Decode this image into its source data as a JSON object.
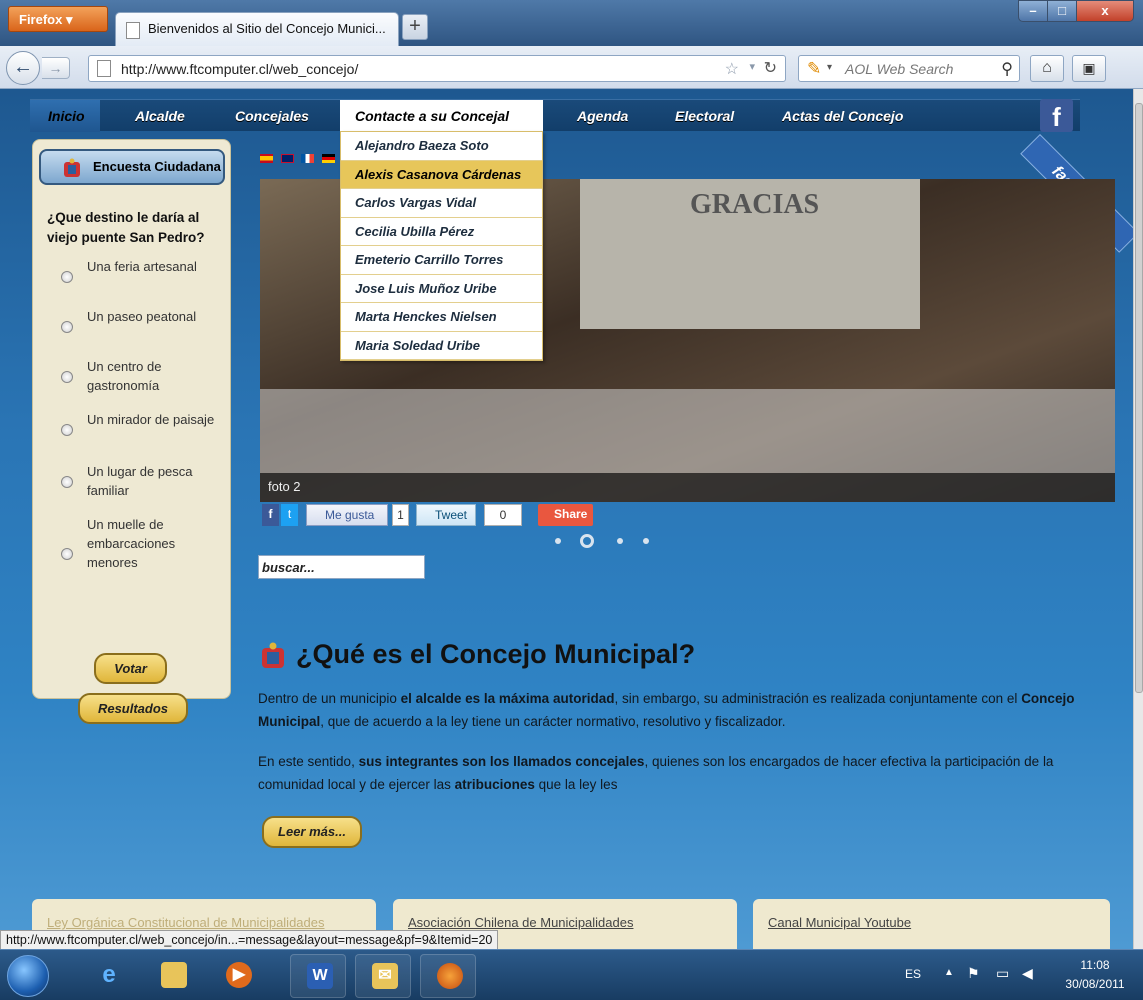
{
  "browser": {
    "menu_button": "Firefox ▾",
    "tab_title": "Bienvenidos al Sitio del Concejo Munici...",
    "new_tab": "+",
    "url": "http://www.ftcomputer.cl/web_concejo/",
    "search_placeholder": "AOL Web Search",
    "status_url": "http://www.ftcomputer.cl/web_concejo/in...=message&layout=message&pf=9&Itemid=20"
  },
  "menu": {
    "items": [
      "Inicio",
      "Alcalde",
      "Concejales",
      "Contacte a su Concejal",
      "Agenda",
      "Electoral",
      "Actas del Concejo"
    ]
  },
  "dropdown": {
    "items": [
      "Alejandro Baeza Soto",
      "Alexis Casanova Cárdenas",
      "Carlos Vargas Vidal",
      "Cecilia Ubilla Pérez",
      "Emeterio Carrillo Torres",
      "Jose Luis Muñoz Uribe",
      "Marta Henckes Nielsen",
      "Maria Soledad Uribe"
    ],
    "hover_index": 1
  },
  "facebook": {
    "badge": "f",
    "ribbon": "facebook"
  },
  "poll": {
    "header": "Encuesta Ciudadana",
    "question": "¿Que destino le daría al viejo puente San Pedro?",
    "options": [
      "Una feria artesanal",
      "Un paseo peatonal",
      "Un centro de gastronomía",
      "Un mirador de paisaje",
      "Un lugar de pesca familiar",
      "Un muelle de embarcaciones menores"
    ],
    "vote_label": "Votar",
    "results_label": "Resultados"
  },
  "slideshow": {
    "screen_text": "GRACIAS",
    "caption": "foto 2",
    "dots": 4,
    "active_dot": 1
  },
  "social": {
    "fb_icon": "f",
    "tw_icon": "t",
    "like": "Me gusta",
    "like_count": "1",
    "tweet": "Tweet",
    "tweet_count": "0",
    "share": "Share"
  },
  "search": {
    "placeholder": "buscar..."
  },
  "article": {
    "title": "¿Qué es el Concejo Municipal?",
    "p1_a": "Dentro de un municipio ",
    "p1_b": "el alcalde es la máxima autoridad",
    "p1_c": ", sin embargo, su administración es realizada conjuntamente con el ",
    "p1_d": "Concejo Municipal",
    "p1_e": ", que de acuerdo a la ley tiene un carácter normativo, resolutivo y fiscalizador.",
    "p2_a": "En este sentido, ",
    "p2_b": "sus integrantes son los llamados concejales",
    "p2_c": ", quienes son los encargados de hacer efectiva la participación de la comunidad local y de ejercer las ",
    "p2_d": "atribuciones",
    "p2_e": " que la ley les",
    "read_more": "Leer más..."
  },
  "bottom_links": [
    "Ley Orgánica Constitucional de Municipalidades",
    "Asociación Chilena de Municipalidades",
    "Canal Municipal Youtube"
  ],
  "taskbar": {
    "lang": "ES",
    "time": "11:08",
    "date": "30/08/2011"
  }
}
